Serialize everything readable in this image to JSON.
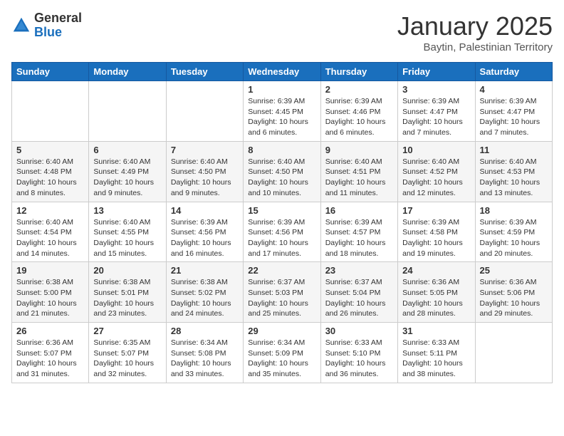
{
  "logo": {
    "general": "General",
    "blue": "Blue"
  },
  "header": {
    "month": "January 2025",
    "location": "Baytin, Palestinian Territory"
  },
  "weekdays": [
    "Sunday",
    "Monday",
    "Tuesday",
    "Wednesday",
    "Thursday",
    "Friday",
    "Saturday"
  ],
  "weeks": [
    [
      {
        "day": "",
        "info": ""
      },
      {
        "day": "",
        "info": ""
      },
      {
        "day": "",
        "info": ""
      },
      {
        "day": "1",
        "info": "Sunrise: 6:39 AM\nSunset: 4:45 PM\nDaylight: 10 hours and 6 minutes."
      },
      {
        "day": "2",
        "info": "Sunrise: 6:39 AM\nSunset: 4:46 PM\nDaylight: 10 hours and 6 minutes."
      },
      {
        "day": "3",
        "info": "Sunrise: 6:39 AM\nSunset: 4:47 PM\nDaylight: 10 hours and 7 minutes."
      },
      {
        "day": "4",
        "info": "Sunrise: 6:39 AM\nSunset: 4:47 PM\nDaylight: 10 hours and 7 minutes."
      }
    ],
    [
      {
        "day": "5",
        "info": "Sunrise: 6:40 AM\nSunset: 4:48 PM\nDaylight: 10 hours and 8 minutes."
      },
      {
        "day": "6",
        "info": "Sunrise: 6:40 AM\nSunset: 4:49 PM\nDaylight: 10 hours and 9 minutes."
      },
      {
        "day": "7",
        "info": "Sunrise: 6:40 AM\nSunset: 4:50 PM\nDaylight: 10 hours and 9 minutes."
      },
      {
        "day": "8",
        "info": "Sunrise: 6:40 AM\nSunset: 4:50 PM\nDaylight: 10 hours and 10 minutes."
      },
      {
        "day": "9",
        "info": "Sunrise: 6:40 AM\nSunset: 4:51 PM\nDaylight: 10 hours and 11 minutes."
      },
      {
        "day": "10",
        "info": "Sunrise: 6:40 AM\nSunset: 4:52 PM\nDaylight: 10 hours and 12 minutes."
      },
      {
        "day": "11",
        "info": "Sunrise: 6:40 AM\nSunset: 4:53 PM\nDaylight: 10 hours and 13 minutes."
      }
    ],
    [
      {
        "day": "12",
        "info": "Sunrise: 6:40 AM\nSunset: 4:54 PM\nDaylight: 10 hours and 14 minutes."
      },
      {
        "day": "13",
        "info": "Sunrise: 6:40 AM\nSunset: 4:55 PM\nDaylight: 10 hours and 15 minutes."
      },
      {
        "day": "14",
        "info": "Sunrise: 6:39 AM\nSunset: 4:56 PM\nDaylight: 10 hours and 16 minutes."
      },
      {
        "day": "15",
        "info": "Sunrise: 6:39 AM\nSunset: 4:56 PM\nDaylight: 10 hours and 17 minutes."
      },
      {
        "day": "16",
        "info": "Sunrise: 6:39 AM\nSunset: 4:57 PM\nDaylight: 10 hours and 18 minutes."
      },
      {
        "day": "17",
        "info": "Sunrise: 6:39 AM\nSunset: 4:58 PM\nDaylight: 10 hours and 19 minutes."
      },
      {
        "day": "18",
        "info": "Sunrise: 6:39 AM\nSunset: 4:59 PM\nDaylight: 10 hours and 20 minutes."
      }
    ],
    [
      {
        "day": "19",
        "info": "Sunrise: 6:38 AM\nSunset: 5:00 PM\nDaylight: 10 hours and 21 minutes."
      },
      {
        "day": "20",
        "info": "Sunrise: 6:38 AM\nSunset: 5:01 PM\nDaylight: 10 hours and 23 minutes."
      },
      {
        "day": "21",
        "info": "Sunrise: 6:38 AM\nSunset: 5:02 PM\nDaylight: 10 hours and 24 minutes."
      },
      {
        "day": "22",
        "info": "Sunrise: 6:37 AM\nSunset: 5:03 PM\nDaylight: 10 hours and 25 minutes."
      },
      {
        "day": "23",
        "info": "Sunrise: 6:37 AM\nSunset: 5:04 PM\nDaylight: 10 hours and 26 minutes."
      },
      {
        "day": "24",
        "info": "Sunrise: 6:36 AM\nSunset: 5:05 PM\nDaylight: 10 hours and 28 minutes."
      },
      {
        "day": "25",
        "info": "Sunrise: 6:36 AM\nSunset: 5:06 PM\nDaylight: 10 hours and 29 minutes."
      }
    ],
    [
      {
        "day": "26",
        "info": "Sunrise: 6:36 AM\nSunset: 5:07 PM\nDaylight: 10 hours and 31 minutes."
      },
      {
        "day": "27",
        "info": "Sunrise: 6:35 AM\nSunset: 5:07 PM\nDaylight: 10 hours and 32 minutes."
      },
      {
        "day": "28",
        "info": "Sunrise: 6:34 AM\nSunset: 5:08 PM\nDaylight: 10 hours and 33 minutes."
      },
      {
        "day": "29",
        "info": "Sunrise: 6:34 AM\nSunset: 5:09 PM\nDaylight: 10 hours and 35 minutes."
      },
      {
        "day": "30",
        "info": "Sunrise: 6:33 AM\nSunset: 5:10 PM\nDaylight: 10 hours and 36 minutes."
      },
      {
        "day": "31",
        "info": "Sunrise: 6:33 AM\nSunset: 5:11 PM\nDaylight: 10 hours and 38 minutes."
      },
      {
        "day": "",
        "info": ""
      }
    ]
  ]
}
